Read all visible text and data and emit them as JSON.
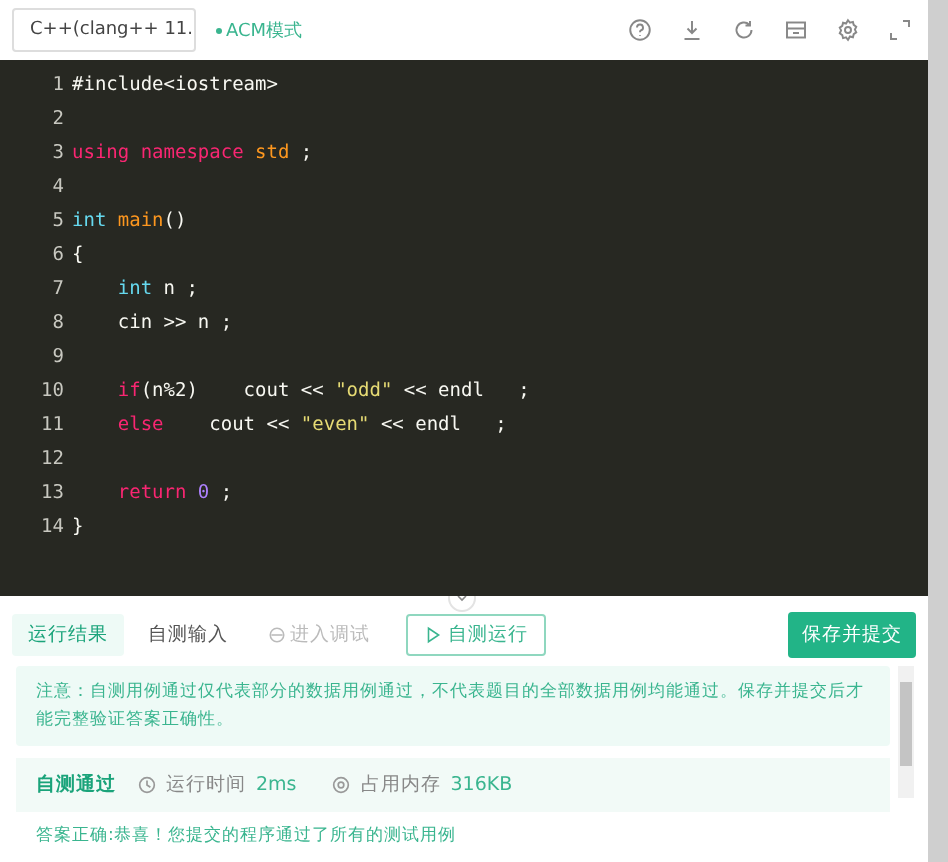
{
  "toolbar": {
    "language": "C++(clang++ 11.",
    "mode": "ACM模式"
  },
  "editor": {
    "lines": [
      {
        "number": "1",
        "tokens": [
          {
            "kind": "plain",
            "text": "#include<iostream>"
          }
        ]
      },
      {
        "number": "2"
      },
      {
        "number": "3",
        "tokens": [
          {
            "kind": "keyword",
            "text": "using namespace "
          },
          {
            "kind": "ns",
            "text": "std"
          },
          {
            "kind": "plain",
            "text": " ;"
          }
        ]
      },
      {
        "number": "4"
      },
      {
        "number": "5",
        "tokens": [
          {
            "kind": "type",
            "text": "int "
          },
          {
            "kind": "func",
            "text": "main"
          },
          {
            "kind": "plain",
            "text": "()"
          }
        ]
      },
      {
        "number": "6",
        "tokens": [
          {
            "kind": "plain",
            "text": "{"
          }
        ]
      },
      {
        "number": "7",
        "indented": true,
        "tokens": [
          {
            "kind": "type",
            "text": "int"
          },
          {
            "kind": "plain",
            "text": " n ;"
          }
        ]
      },
      {
        "number": "8",
        "indented": true,
        "tokens": [
          {
            "kind": "plain",
            "text": "cin >> n ;"
          }
        ]
      },
      {
        "number": "9"
      },
      {
        "number": "10",
        "indented": true,
        "tokens": [
          {
            "kind": "keyword",
            "text": "if"
          },
          {
            "kind": "plain",
            "text": "(n%2)    cout << "
          },
          {
            "kind": "string",
            "text": "\"odd\""
          },
          {
            "kind": "plain",
            "text": " << endl   ;"
          }
        ]
      },
      {
        "number": "11",
        "indented": true,
        "tokens": [
          {
            "kind": "keyword",
            "text": "else"
          },
          {
            "kind": "plain",
            "text": "    cout << "
          },
          {
            "kind": "string",
            "text": "\"even\""
          },
          {
            "kind": "plain",
            "text": " << endl   ;"
          }
        ]
      },
      {
        "number": "12"
      },
      {
        "number": "13",
        "indented": true,
        "tokens": [
          {
            "kind": "keyword",
            "text": "return "
          },
          {
            "kind": "number",
            "text": "0"
          },
          {
            "kind": "plain",
            "text": " ;"
          }
        ]
      },
      {
        "number": "14",
        "tokens": [
          {
            "kind": "plain",
            "text": "}"
          }
        ]
      }
    ]
  },
  "panel": {
    "tabs": [
      {
        "label": "运行结果",
        "selected": true,
        "disabled": false
      },
      {
        "label": "自测输入",
        "selected": false,
        "disabled": false
      },
      {
        "label": "进入调试",
        "selected": false,
        "disabled": true
      }
    ],
    "run_button": "自测运行",
    "submit_button": "保存并提交",
    "notice": "注意：自测用例通过仅代表部分的数据用例通过，不代表题目的全部数据用例均能通过。保存并提交后才能完整验证答案正确性。",
    "result": {
      "status": "自测通过",
      "time_label": "运行时间",
      "time": "2ms",
      "memory_label": "占用内存",
      "memory": "316KB"
    },
    "message": "答案正确:恭喜！您提交的程序通过了所有的测试用例"
  }
}
